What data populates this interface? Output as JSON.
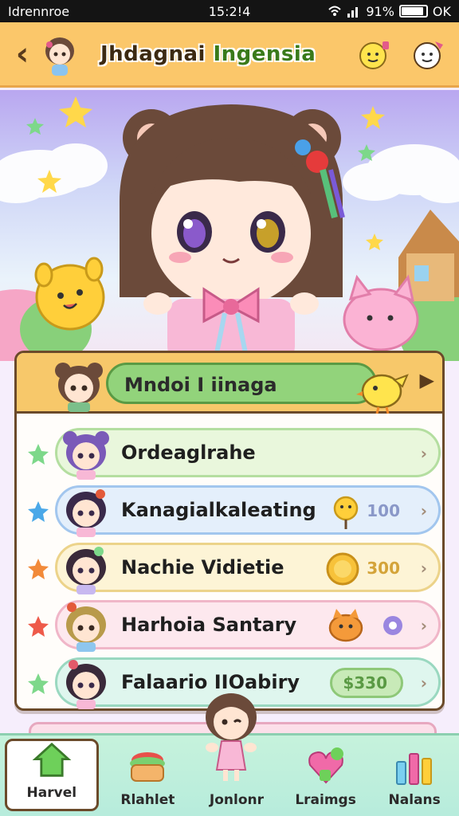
{
  "status_bar": {
    "carrier": "Idrennroe",
    "time": "15:2!4",
    "battery": "91%",
    "signal_text": "OK"
  },
  "header": {
    "back_label": "‹",
    "title_main": "Jhdagnai",
    "title_highlight": "Ingensia"
  },
  "menu": {
    "featured": {
      "label": "Mndoi I iinaga"
    },
    "rows": [
      {
        "name": "Ordeaglrahe",
        "value": "",
        "theme": "green"
      },
      {
        "name": "Kanagialkaleating",
        "value": "100",
        "theme": "blue"
      },
      {
        "name": "Nachie Vidietie",
        "value": "300",
        "theme": "yellow"
      },
      {
        "name": "Harhoia Santary",
        "value": "",
        "theme": "pink"
      },
      {
        "name": "Falaario IIOabiry",
        "value": "$330",
        "theme": "teal"
      }
    ]
  },
  "nav": {
    "items": [
      {
        "label": "Harvel",
        "icon": "home-icon",
        "active": true
      },
      {
        "label": "Rlahlet",
        "icon": "cake-icon",
        "active": false
      },
      {
        "label": "Jonlonr",
        "icon": "character-icon",
        "active": false
      },
      {
        "label": "Lraimgs",
        "icon": "heart-blocks-icon",
        "active": false
      },
      {
        "label": "Nalans",
        "icon": "stats-icon",
        "active": false
      }
    ]
  },
  "colors": {
    "header_bg": "#fbc76a",
    "featured_bar": "#92d37b",
    "row_green": "#e9f7dc",
    "row_blue": "#e4effb",
    "row_yellow": "#fdf4d6",
    "row_pink": "#fde8ee",
    "row_teal": "#dff6ee",
    "nav_bg": "#c6f2dc"
  }
}
